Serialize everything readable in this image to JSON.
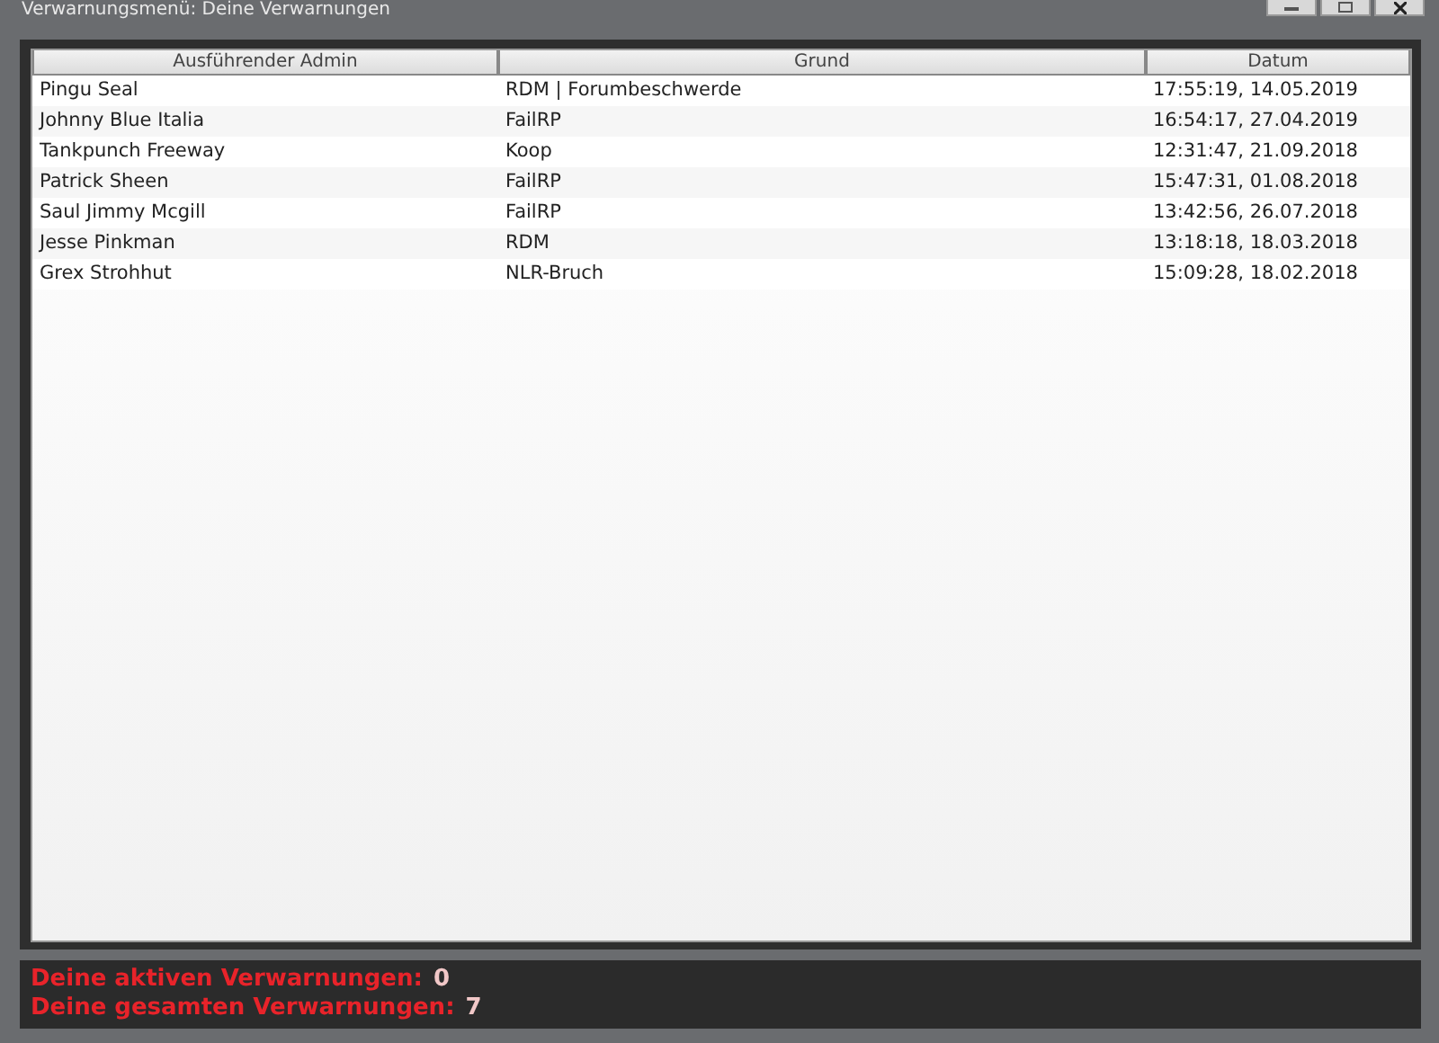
{
  "window": {
    "title": "Verwarnungsmenü: Deine Verwarnungen"
  },
  "table": {
    "columns": [
      "Ausführender Admin",
      "Grund",
      "Datum"
    ],
    "rows": [
      {
        "admin": "Pingu Seal",
        "reason": "RDM | Forumbeschwerde",
        "date": "17:55:19, 14.05.2019"
      },
      {
        "admin": "Johnny Blue Italia",
        "reason": "FailRP",
        "date": "16:54:17, 27.04.2019"
      },
      {
        "admin": "Tankpunch Freeway",
        "reason": "Koop",
        "date": "12:31:47, 21.09.2018"
      },
      {
        "admin": "Patrick Sheen",
        "reason": "FailRP",
        "date": "15:47:31, 01.08.2018"
      },
      {
        "admin": "Saul Jimmy Mcgill",
        "reason": "FailRP",
        "date": "13:42:56, 26.07.2018"
      },
      {
        "admin": "Jesse Pinkman",
        "reason": "RDM",
        "date": "13:18:18, 18.03.2018"
      },
      {
        "admin": "Grex Strohhut",
        "reason": "NLR-Bruch",
        "date": "15:09:28, 18.02.2018"
      }
    ]
  },
  "summary": [
    {
      "label": "Deine aktiven Verwarnungen:",
      "value": "0"
    },
    {
      "label": "Deine gesamten Verwarnungen:",
      "value": "7"
    }
  ]
}
